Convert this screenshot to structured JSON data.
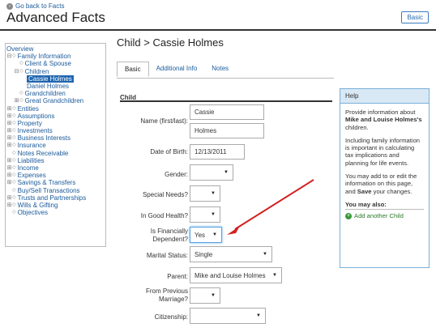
{
  "header": {
    "back_label": "Go back to Facts",
    "title": "Advanced Facts",
    "basic_button": "Basic"
  },
  "tree": [
    {
      "label": "Overview",
      "indent": 0,
      "toggle": "",
      "icon": false,
      "selected": false
    },
    {
      "label": "Family Information",
      "indent": 0,
      "toggle": "⊟",
      "icon": true,
      "selected": false
    },
    {
      "label": "Client & Spouse",
      "indent": 1,
      "toggle": "",
      "icon": true,
      "selected": false
    },
    {
      "label": "Children",
      "indent": 1,
      "toggle": "⊟",
      "icon": true,
      "selected": false
    },
    {
      "label": "Cassie Holmes",
      "indent": 2,
      "toggle": "",
      "icon": false,
      "selected": true
    },
    {
      "label": "Daniel Holmes",
      "indent": 2,
      "toggle": "",
      "icon": false,
      "selected": false
    },
    {
      "label": "Grandchildren",
      "indent": 1,
      "toggle": "",
      "icon": true,
      "selected": false
    },
    {
      "label": "Great Grandchildren",
      "indent": 1,
      "toggle": "⊞",
      "icon": true,
      "selected": false
    },
    {
      "label": "Entities",
      "indent": 0,
      "toggle": "⊞",
      "icon": true,
      "selected": false
    },
    {
      "label": "Assumptions",
      "indent": 0,
      "toggle": "⊞",
      "icon": true,
      "selected": false
    },
    {
      "label": "Property",
      "indent": 0,
      "toggle": "⊞",
      "icon": true,
      "selected": false
    },
    {
      "label": "Investments",
      "indent": 0,
      "toggle": "⊞",
      "icon": true,
      "selected": false
    },
    {
      "label": "Business Interests",
      "indent": 0,
      "toggle": "⊞",
      "icon": true,
      "selected": false
    },
    {
      "label": "Insurance",
      "indent": 0,
      "toggle": "⊞",
      "icon": true,
      "selected": false
    },
    {
      "label": "Notes Receivable",
      "indent": 0,
      "toggle": "",
      "icon": true,
      "selected": false
    },
    {
      "label": "Liabilities",
      "indent": 0,
      "toggle": "⊞",
      "icon": true,
      "selected": false
    },
    {
      "label": "Income",
      "indent": 0,
      "toggle": "⊞",
      "icon": true,
      "selected": false
    },
    {
      "label": "Expenses",
      "indent": 0,
      "toggle": "⊞",
      "icon": true,
      "selected": false
    },
    {
      "label": "Savings & Transfers",
      "indent": 0,
      "toggle": "⊞",
      "icon": true,
      "selected": false
    },
    {
      "label": "Buy/Sell Transactions",
      "indent": 0,
      "toggle": "",
      "icon": true,
      "selected": false
    },
    {
      "label": "Trusts and Partnerships",
      "indent": 0,
      "toggle": "⊞",
      "icon": true,
      "selected": false
    },
    {
      "label": "Wills & Gifting",
      "indent": 0,
      "toggle": "⊞",
      "icon": true,
      "selected": false
    },
    {
      "label": "Objectives",
      "indent": 0,
      "toggle": "",
      "icon": true,
      "selected": false
    }
  ],
  "main": {
    "section_title": "Child > Cassie Holmes",
    "tabs": [
      "Basic",
      "Additional Info",
      "Notes"
    ],
    "active_tab": "Basic",
    "group_title": "Child"
  },
  "form": {
    "name_label": "Name (first/last):",
    "first_name": "Cassie",
    "last_name": "Holmes",
    "dob_label": "Date of Birth:",
    "dob": "12/13/2011",
    "gender_label": "Gender:",
    "gender": "",
    "special_needs_label": "Special Needs?",
    "special_needs": "",
    "good_health_label": "In Good Health?",
    "good_health": "",
    "fin_dep_label_1": "Is Financially",
    "fin_dep_label_2": "Dependent?",
    "fin_dep": "Yes",
    "marital_label": "Marital Status:",
    "marital": "Single",
    "parent_label": "Parent:",
    "parent": "Mike and Louise Holmes",
    "prev_marriage_label_1": "From Previous",
    "prev_marriage_label_2": "Marriage?",
    "prev_marriage": "",
    "citizenship_label": "Citizenship:",
    "citizenship": ""
  },
  "help": {
    "title": "Help",
    "p1_pre": "Provide information about ",
    "p1_bold": "Mike and Louise Holmes's",
    "p1_post": " children.",
    "p2": "Including family information is important in calculating tax implications and planning for life events.",
    "p3_pre": "You may add to or edit the information on this page, and ",
    "p3_bold": "Save",
    "p3_post": " your changes.",
    "also": "You may also:",
    "add_child": "Add another Child"
  },
  "colors": {
    "accent": "#1e65b0",
    "arrow": "#d42020",
    "help_header": "#d8e8f5"
  }
}
